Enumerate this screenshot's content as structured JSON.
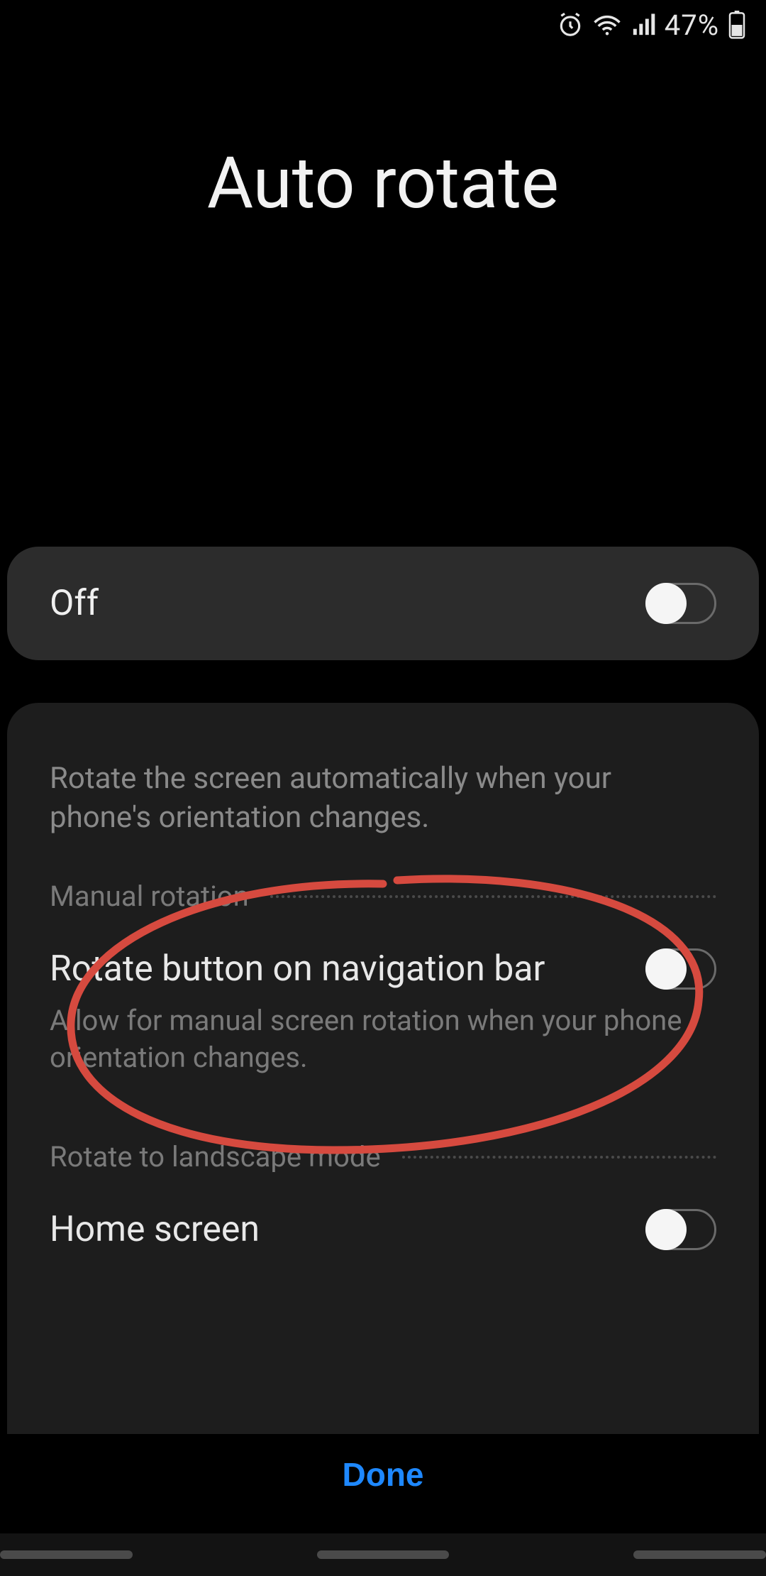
{
  "status": {
    "battery_percent": "47%"
  },
  "page": {
    "title": "Auto rotate"
  },
  "master": {
    "label": "Off",
    "state": "off"
  },
  "details": {
    "description": "Rotate the screen automatically when your phone's orientation changes.",
    "section1": {
      "header": "Manual rotation",
      "item_title": "Rotate button on navigation bar",
      "item_sub": "Allow for manual screen rotation when your phone orientation changes.",
      "state": "off"
    },
    "section2": {
      "header": "Rotate to landscape mode",
      "item_title": "Home screen",
      "state": "off"
    }
  },
  "actions": {
    "done": "Done"
  }
}
